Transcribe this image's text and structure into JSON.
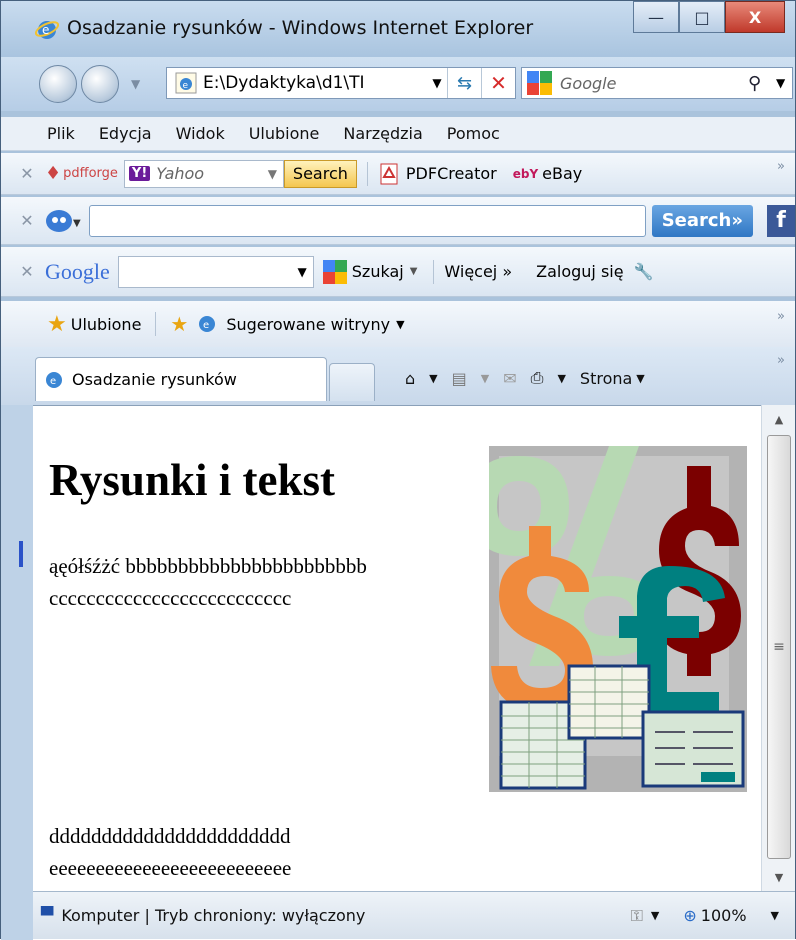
{
  "window": {
    "title": "Osadzanie rysunków - Windows Internet Explorer",
    "min": "—",
    "max": "□",
    "close": "X"
  },
  "nav": {
    "address": "E:\\Dydaktyka\\d1\\TI",
    "search_placeholder": "Google"
  },
  "menu": [
    "Plik",
    "Edycja",
    "Widok",
    "Ulubione",
    "Narzędzia",
    "Pomoc"
  ],
  "toolbar_pdf": {
    "brand": "pdfforge",
    "yahoo": "Y!",
    "yahoo_placeholder": "Yahoo",
    "search": "Search",
    "pdfcreator": "PDFCreator",
    "ebay_logo": "ebY",
    "ebay": "eBay"
  },
  "toolbar_bing": {
    "search": "Search»",
    "fb": "f"
  },
  "toolbar_google": {
    "logo": "Google",
    "szukaj": "Szukaj",
    "wiecej": "Więcej »",
    "zaloguj": "Zaloguj się"
  },
  "favorites": {
    "ulubione": "Ulubione",
    "sugerowane": "Sugerowane witryny"
  },
  "tab": {
    "label": "Osadzanie rysunków"
  },
  "commands": {
    "strona": "Strona"
  },
  "page": {
    "heading": "Rysunki i tekst",
    "line1": "ąęółśźżć bbbbbbbbbbbbbbbbbbbbbbb",
    "line2": "cccccccccccccccccccccccccc",
    "line3": "ddddddddddddddddddddddd",
    "line4": "eeeeeeeeeeeeeeeeeeeeeeeeee"
  },
  "status": {
    "zone": "Komputer | Tryb chroniony: wyłączony",
    "zoom": "100%"
  },
  "icons": {
    "ie": "ie-icon",
    "back": "back-icon",
    "forward": "forward-icon",
    "home": "home-icon",
    "rss": "rss-icon",
    "print": "print-icon",
    "mail": "mail-icon"
  }
}
